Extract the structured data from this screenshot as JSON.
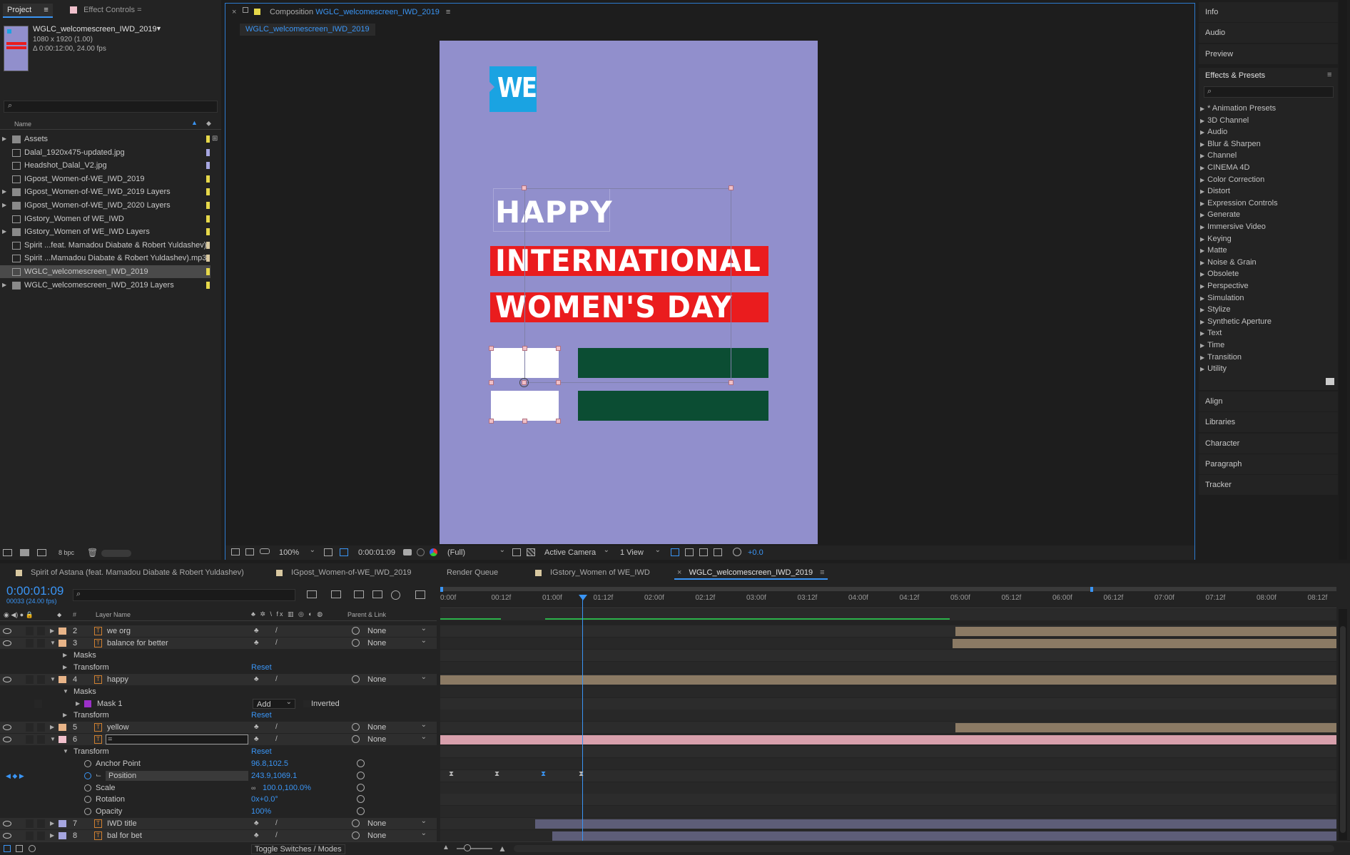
{
  "project_panel": {
    "tab_project": "Project",
    "tab_effect_controls": "Effect Controls",
    "effect_controls_sep": "=",
    "preview_item": {
      "name": "WGLC_welcomescreen_IWD_2019",
      "resolution": "1080 x 1920 (1.00)",
      "duration": "Δ 0:00:12:00, 24.00 fps"
    },
    "column_name": "Name",
    "bpc": "8 bpc",
    "items": [
      {
        "name": "Assets",
        "type": "folder",
        "color": "#e6d84a",
        "expand": true
      },
      {
        "name": "Dalal_1920x475-updated.jpg",
        "type": "file",
        "color": "#a6a6e0",
        "expand": false
      },
      {
        "name": "Headshot_Dalal_V2.jpg",
        "type": "file",
        "color": "#a6a6e0",
        "expand": false
      },
      {
        "name": "IGpost_Women-of-WE_IWD_2019",
        "type": "comp",
        "color": "#e6d84a",
        "expand": false
      },
      {
        "name": "IGpost_Women-of-WE_IWD_2019 Layers",
        "type": "folder",
        "color": "#e6d84a",
        "expand": true
      },
      {
        "name": "IGpost_Women-of-WE_IWD_2020 Layers",
        "type": "folder",
        "color": "#e6d84a",
        "expand": true
      },
      {
        "name": "IGstory_Women of WE_IWD",
        "type": "comp",
        "color": "#e6d84a",
        "expand": false
      },
      {
        "name": "IGstory_Women of WE_IWD Layers",
        "type": "folder",
        "color": "#e6d84a",
        "expand": true
      },
      {
        "name": "Spirit ...feat. Mamadou Diabate & Robert Yuldashev)",
        "type": "file",
        "color": "#d8c8a0",
        "expand": false
      },
      {
        "name": "Spirit ...Mamadou Diabate & Robert Yuldashev).mp3",
        "type": "file",
        "color": "#d8c8a0",
        "expand": false
      },
      {
        "name": "WGLC_welcomescreen_IWD_2019",
        "type": "comp",
        "color": "#e6d84a",
        "expand": false,
        "selected": true
      },
      {
        "name": "WGLC_welcomescreen_IWD_2019 Layers",
        "type": "folder",
        "color": "#e6d84a",
        "expand": true
      }
    ]
  },
  "composition_panel": {
    "title_prefix": "Composition",
    "title_name": "WGLC_welcomescreen_IWD_2019",
    "tab": "WGLC_welcomescreen_IWD_2019",
    "artwork": {
      "logo_text": "WE",
      "line1": "HAPPY",
      "line2": "INTERNATIONAL",
      "line3": "WOMEN'S DAY",
      "bg_color": "#918fcc",
      "red_color": "#ea1c1e",
      "green_color": "#0b4d33",
      "logo_color": "#1aa3e2"
    },
    "toolbar": {
      "zoom": "100%",
      "timecode": "0:00:01:09",
      "resolution": "(Full)",
      "camera": "Active Camera",
      "view": "1 View",
      "exposure": "+0.0"
    }
  },
  "right_panel": {
    "top_items": [
      "Info",
      "Audio",
      "Preview"
    ],
    "effects_title": "Effects & Presets",
    "effects": [
      "* Animation Presets",
      "3D Channel",
      "Audio",
      "Blur & Sharpen",
      "Channel",
      "CINEMA 4D",
      "Color Correction",
      "Distort",
      "Expression Controls",
      "Generate",
      "Immersive Video",
      "Keying",
      "Matte",
      "Noise & Grain",
      "Obsolete",
      "Perspective",
      "Simulation",
      "Stylize",
      "Synthetic Aperture",
      "Text",
      "Time",
      "Transition",
      "Utility"
    ],
    "bottom_items": [
      "Align",
      "Libraries",
      "Character",
      "Paragraph",
      "Tracker"
    ]
  },
  "timeline": {
    "tabs": [
      {
        "name": "Spirit of Astana (feat. Mamadou Diabate & Robert Yuldashev)",
        "color": "#d8c8a0"
      },
      {
        "name": "IGpost_Women-of-WE_IWD_2019",
        "color": "#d8c8a0"
      },
      {
        "name": "Render Queue",
        "color": ""
      },
      {
        "name": "IGstory_Women of WE_IWD",
        "color": "#d8c8a0"
      },
      {
        "name": "WGLC_welcomescreen_IWD_2019",
        "color": "",
        "active": true
      }
    ],
    "timecode": "0:00:01:09",
    "frame_info": "00033 (24.00 fps)",
    "col_layer_name": "Layer Name",
    "col_parent": "Parent & Link",
    "col_hash": "#",
    "ruler": [
      "0:00f",
      "00:12f",
      "01:00f",
      "01:12f",
      "02:00f",
      "02:12f",
      "03:00f",
      "03:12f",
      "04:00f",
      "04:12f",
      "05:00f",
      "05:12f",
      "06:00f",
      "06:12f",
      "07:00f",
      "07:12f",
      "08:00f",
      "08:12f"
    ],
    "toggle_label": "Toggle Switches / Modes",
    "rows": [
      {
        "kind": "layer",
        "num": "2",
        "name": "we org",
        "color": "#e8b488",
        "parent": "None",
        "bar": {
          "from": 0.575,
          "to": 1.0,
          "color": "#8b7a64"
        }
      },
      {
        "kind": "layer",
        "num": "3",
        "name": "balance for better",
        "color": "#e8b488",
        "parent": "None",
        "expanded": true,
        "bar": {
          "from": 0.572,
          "to": 1.0,
          "color": "#8b7a64"
        }
      },
      {
        "kind": "group",
        "name": "Masks",
        "indent": 1
      },
      {
        "kind": "group",
        "name": "Transform",
        "indent": 1,
        "value": "Reset"
      },
      {
        "kind": "layer",
        "num": "4",
        "name": "happy",
        "color": "#e8b488",
        "parent": "None",
        "expanded": true,
        "bar": {
          "from": 0.0,
          "to": 1.0,
          "color": "#8b7a64"
        }
      },
      {
        "kind": "group",
        "name": "Masks",
        "indent": 1,
        "open": true
      },
      {
        "kind": "mask",
        "name": "Mask 1",
        "mode": "Add",
        "inverted": "Inverted"
      },
      {
        "kind": "group",
        "name": "Transform",
        "indent": 1,
        "value": "Reset"
      },
      {
        "kind": "layer",
        "num": "5",
        "name": "yellow",
        "color": "#e8b488",
        "parent": "None",
        "bar": {
          "from": 0.575,
          "to": 1.0,
          "color": "#8b7a64"
        }
      },
      {
        "kind": "layer",
        "num": "6",
        "name": "=",
        "color": "#f0c0cc",
        "parent": "None",
        "expanded": true,
        "editing": true,
        "bar": {
          "from": 0.0,
          "to": 1.0,
          "color": "#d8a0ac"
        }
      },
      {
        "kind": "group",
        "name": "Transform",
        "indent": 1,
        "value": "Reset",
        "open": true
      },
      {
        "kind": "prop",
        "name": "Anchor Point",
        "value": "96.8,102.5"
      },
      {
        "kind": "prop",
        "name": "Position",
        "value": "243.9,1069.1",
        "selected": true
      },
      {
        "kind": "prop",
        "name": "Scale",
        "value": "100.0,100.0%"
      },
      {
        "kind": "prop",
        "name": "Rotation",
        "value": "0x+0.0°"
      },
      {
        "kind": "prop",
        "name": "Opacity",
        "value": "100%"
      },
      {
        "kind": "layer",
        "num": "7",
        "name": "IWD title",
        "color": "#a6a6e0",
        "parent": "None",
        "bar": {
          "from": 0.106,
          "to": 1.0,
          "color": "#5d5d78"
        }
      },
      {
        "kind": "layer",
        "num": "8",
        "name": "bal for bet",
        "color": "#a6a6e0",
        "parent": "None",
        "bar": {
          "from": 0.125,
          "to": 1.0,
          "color": "#5d5d78"
        }
      }
    ]
  }
}
